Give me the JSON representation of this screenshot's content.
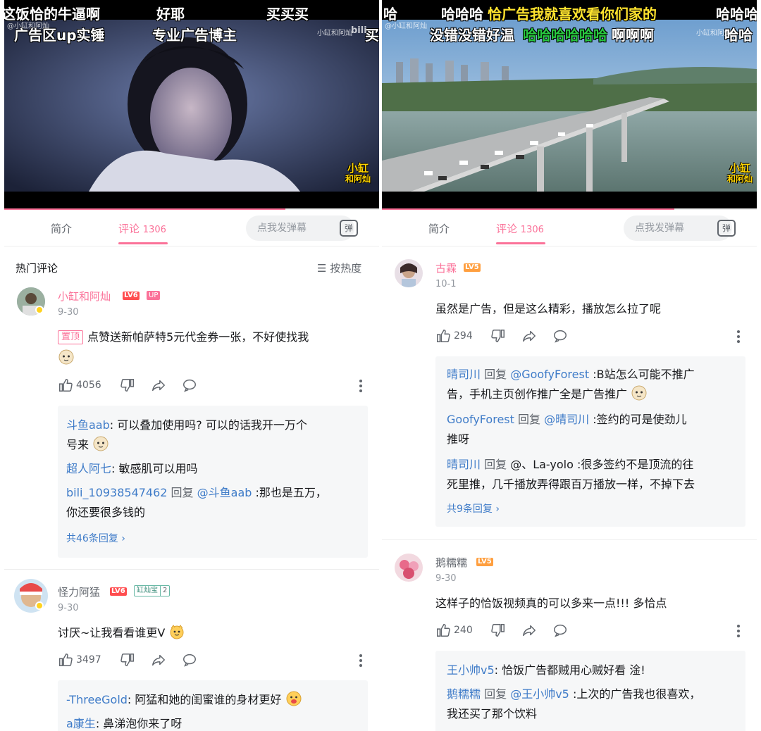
{
  "left": {
    "danmaku": [
      "这饭恰的牛逼啊",
      "好耶",
      "买买买",
      "广告区up实锤",
      "专业广告博主",
      "买"
    ],
    "watermark_top": "@小缸和阿灿",
    "watermark_right": "小缸和阿灿",
    "watermark_site": "bili",
    "logo_line1": "小缸",
    "logo_line2": "和阿灿",
    "progress": 0.75,
    "tabs": {
      "intro": "简介",
      "comments": "评论",
      "comment_count": "1306"
    },
    "danmaku_input_placeholder": "点我发弹幕",
    "danmaku_btn": "弹",
    "hot_title": "热门评论",
    "sort_label": "按热度",
    "c1": {
      "user": "小缸和阿灿",
      "level": "LV6",
      "up_tag": "UP",
      "date": "9-30",
      "pin": "置顶",
      "text": "点赞送新帕萨特5元代金券一张，不好使找我",
      "likes": "4056",
      "replies": [
        {
          "name": "斗鱼aab",
          "text": ": 可以叠加使用吗? 可以的话我开一万个",
          "text2": "号来"
        },
        {
          "name": "超人阿七",
          "text": ": 敏感肌可以用吗"
        },
        {
          "name": "bili_10938547462",
          "reply_word": " 回复 ",
          "at": "@斗鱼aab",
          "text": " :那也是五万，",
          "text2": "你还要很多钱的"
        }
      ],
      "more": "共46条回复"
    },
    "c2": {
      "user": "怪力阿猛",
      "level": "LV6",
      "fan_tag": "缸灿宝",
      "fan_level": "2",
      "date": "9-30",
      "text": "讨厌~让我看看谁更V",
      "likes": "3497",
      "replies": [
        {
          "name": "-ThreeGold",
          "text": ": 阿猛和她的闺蜜谁的身材更好"
        },
        {
          "name": "a康生",
          "text": ": 鼻涕泡你来了呀"
        }
      ]
    }
  },
  "right": {
    "danmaku": [
      "哈",
      "哈哈哈",
      "恰广告我就喜欢看你们家的",
      "哈哈哈",
      "没错没错好温",
      "哈哈哈哈哈哈",
      "啊啊啊",
      "哈哈"
    ],
    "watermark_top": "@小缸和阿灿",
    "watermark_right": "小缸和阿灿",
    "logo_line1": "小缸",
    "logo_line2": "和阿灿",
    "progress": 0.78,
    "tabs": {
      "intro": "简介",
      "comments": "评论",
      "comment_count": "1306"
    },
    "danmaku_input_placeholder": "点我发弹幕",
    "danmaku_btn": "弹",
    "c1": {
      "user": "古霖",
      "level": "LV5",
      "date": "10-1",
      "text": "虽然是广告，但是这么精彩，播放怎么拉了呢",
      "likes": "294",
      "replies": [
        {
          "name": "晴司川",
          "reply_word": " 回复 ",
          "at": "@GoofyForest",
          "text": " :B站怎么可能不推广",
          "text2": "告，手机主页创作推广全是广告推广"
        },
        {
          "name": "GoofyForest",
          "reply_word": " 回复 ",
          "at": "@晴司川",
          "text": " :签约的可是使劲儿",
          "text2": "推呀"
        },
        {
          "name": "晴司川",
          "reply_word": " 回复 ",
          "at": "@、La-yolo",
          "text": " :很多签约不是顶流的往",
          "text2": "死里推，几千播放弄得跟百万播放一样，不掉下去"
        }
      ],
      "more": "共9条回复"
    },
    "c2": {
      "user": "鹅糯糯",
      "level": "LV5",
      "date": "9-30",
      "text": "这样子的恰饭视频真的可以多来一点!!! 多恰点",
      "likes": "240",
      "replies": [
        {
          "name": "王小帅v5",
          "text": ": 恰饭广告都贼用心贼好看 淦!"
        },
        {
          "name": "鹅糯糯",
          "reply_word": " 回复 ",
          "at": "@王小帅v5",
          "text": " :上次的广告我也很喜欢，",
          "text2": "我还买了那个饮料"
        }
      ]
    }
  },
  "colors": {
    "accent": "#fb7299",
    "link": "#3e7bc8",
    "lv6": "#ff4d4f",
    "lv5": "#ff9f3f"
  }
}
